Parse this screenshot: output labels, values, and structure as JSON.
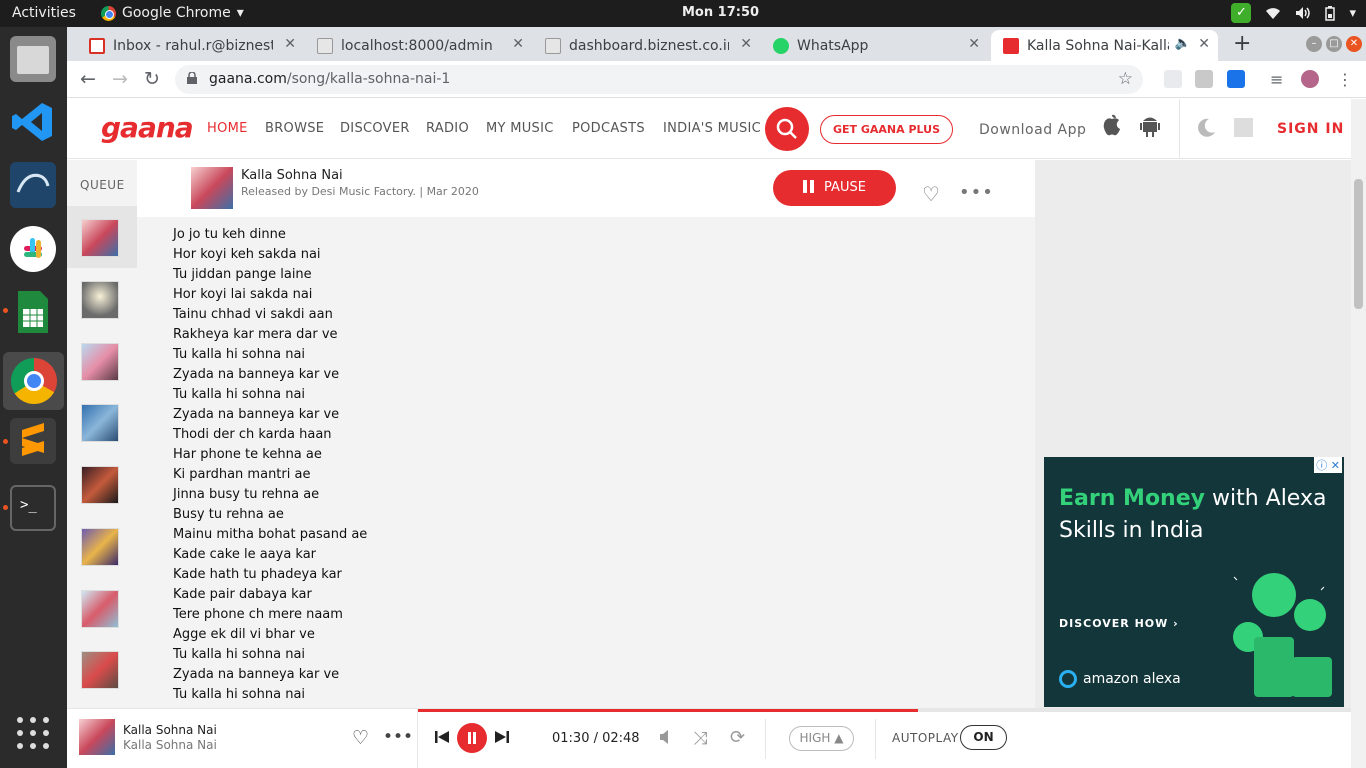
{
  "os": {
    "activities": "Activities",
    "app_menu": "Google Chrome",
    "clock": "Mon 17:50"
  },
  "browser": {
    "tabs": [
      {
        "label": "Inbox - rahul.r@biznest.co.in",
        "favicon": "gmail"
      },
      {
        "label": "localhost:8000/admin",
        "favicon": "biznest"
      },
      {
        "label": "dashboard.biznest.co.in",
        "favicon": "biznest"
      },
      {
        "label": "WhatsApp",
        "favicon": "whatsapp"
      },
      {
        "label": "Kalla Sohna Nai-Kalla Sohna Nai",
        "favicon": "gaana"
      }
    ],
    "url_host": "gaana.com",
    "url_path": "/song/kalla-sohna-nai-1"
  },
  "header": {
    "logo": "gaana",
    "nav": [
      "HOME",
      "BROWSE",
      "DISCOVER",
      "RADIO",
      "MY MUSIC",
      "PODCASTS",
      "INDIA'S MUSIC"
    ],
    "plus_button": "GET GAANA PLUS",
    "download": "Download App",
    "signin": "SIGN IN"
  },
  "queue": {
    "title": "QUEUE"
  },
  "song": {
    "title": "Kalla Sohna Nai",
    "released": "Released by Desi Music Factory. | Mar 2020",
    "pause": "PAUSE"
  },
  "lyrics": [
    "Jo jo tu keh dinne",
    "Hor koyi keh sakda nai",
    "Tu jiddan pange laine",
    "Hor koyi lai sakda nai",
    "Tainu chhad vi sakdi aan",
    "Rakheya kar mera dar ve",
    "Tu kalla hi sohna nai",
    "Zyada na banneya kar ve",
    "Tu kalla hi sohna nai",
    "Zyada na banneya kar ve",
    "Thodi der ch karda haan",
    "Har phone te kehna ae",
    "Ki pardhan mantri ae",
    "Jinna busy tu rehna ae",
    "Busy tu rehna ae",
    "Mainu mitha bohat pasand ae",
    "Kade cake le aaya kar",
    "Kade hath tu phadeya kar",
    "Kade pair dabaya kar",
    "Tere phone ch mere naam",
    "Agge ek dil vi bhar ve",
    "Tu kalla hi sohna nai",
    "Zyada na banneya kar ve",
    "Tu kalla hi sohna nai"
  ],
  "ad": {
    "headline_green": "Earn Money",
    "headline_rest": " with Alexa Skills in India",
    "cta": "DISCOVER HOW ›",
    "brand": "amazon alexa"
  },
  "player": {
    "title": "Kalla Sohna Nai",
    "subtitle": "Kalla Sohna Nai",
    "time": "01:30 / 02:48",
    "progress": 0.536,
    "quality": "HIGH ▲",
    "autoplay_label": "AUTOPLAY",
    "autoplay_state": "ON"
  },
  "colors": {
    "brand": "#e72c30",
    "ad_bg": "#13363a",
    "ad_green": "#33d17a"
  }
}
